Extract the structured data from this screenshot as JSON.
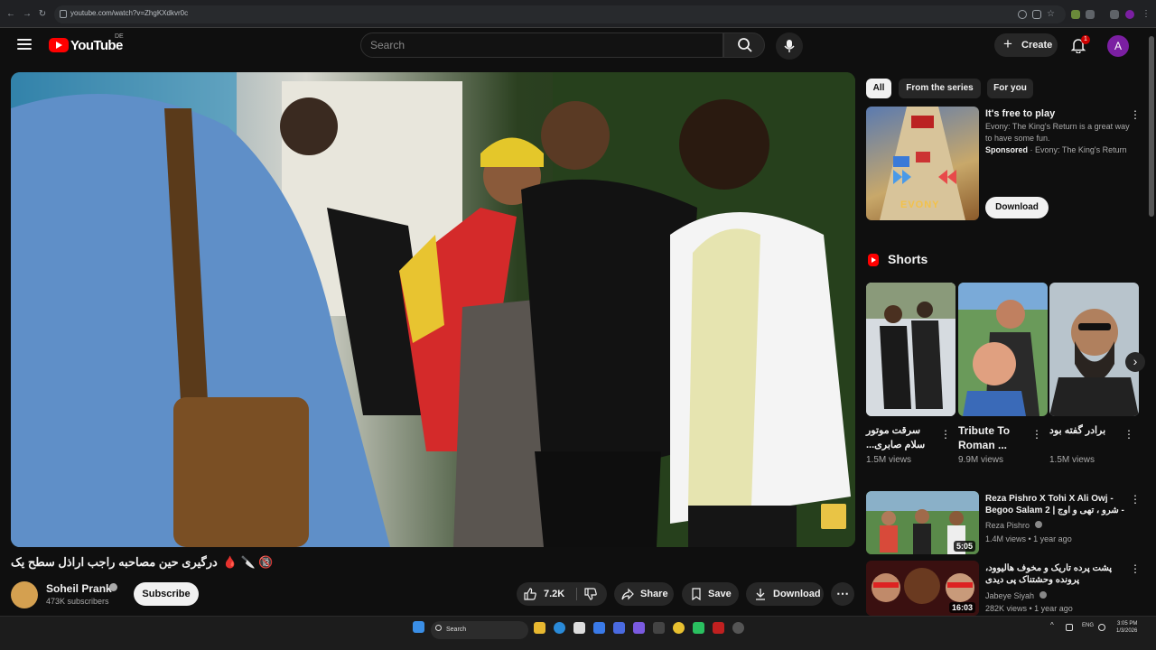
{
  "browser": {
    "url": "youtube.com/watch?v=ZhgKXdkvr0c"
  },
  "header": {
    "logo_text": "YouTube",
    "country_code": "DE",
    "search_placeholder": "Search",
    "create_label": "Create",
    "notification_count": "1",
    "avatar_letter": "A"
  },
  "video": {
    "title": "درگیری حین مصاحبه راجب اراذل سطح یک",
    "title_emojis": "🩸 🔪 🔞",
    "channel_name": "Soheil Prank",
    "subscribers": "473K subscribers",
    "subscribe_label": "Subscribe",
    "likes": "7.2K",
    "share_label": "Share",
    "save_label": "Save",
    "download_label": "Download"
  },
  "sidebar": {
    "chips": [
      "All",
      "From the series",
      "For you"
    ],
    "ad": {
      "title": "It's free to play",
      "description": "Evony: The King's Return is a great way to have some fun.",
      "sponsored_label": "Sponsored",
      "sponsor_name": "Evony: The King's Return",
      "download_label": "Download",
      "thumb_text": "EVONY"
    },
    "shorts_title": "Shorts",
    "shorts": [
      {
        "title": "سرقت موتور سلام صابری...",
        "views": "1.5M views"
      },
      {
        "title": "Tribute To Roman ...",
        "views": "9.9M views"
      },
      {
        "title": "برادر گفته بود",
        "views": "1.5M views"
      }
    ],
    "recommended": [
      {
        "title": "Reza Pishro X Tohi X Ali Owj - Begoo Salam 2 | شرو ، تهی و اوج -",
        "channel": "Reza Pishro",
        "meta": "1.4M views • 1 year ago",
        "duration": "5:05"
      },
      {
        "title": "پشت پرده تاریک و مخوف هالیوود، پرونده وحشتناک پی دیدی",
        "channel": "Jabeye Siyah",
        "meta": "282K views • 1 year ago",
        "duration": "16:03"
      }
    ]
  },
  "taskbar": {
    "search_label": "Search",
    "lang": "ENG",
    "time": "3:05 PM",
    "date": "1/3/2026"
  },
  "colors": {
    "background": "#0f0f0f",
    "accent_red": "#ff0000",
    "chip_active": "#f1f1f1",
    "pill": "#272727"
  }
}
